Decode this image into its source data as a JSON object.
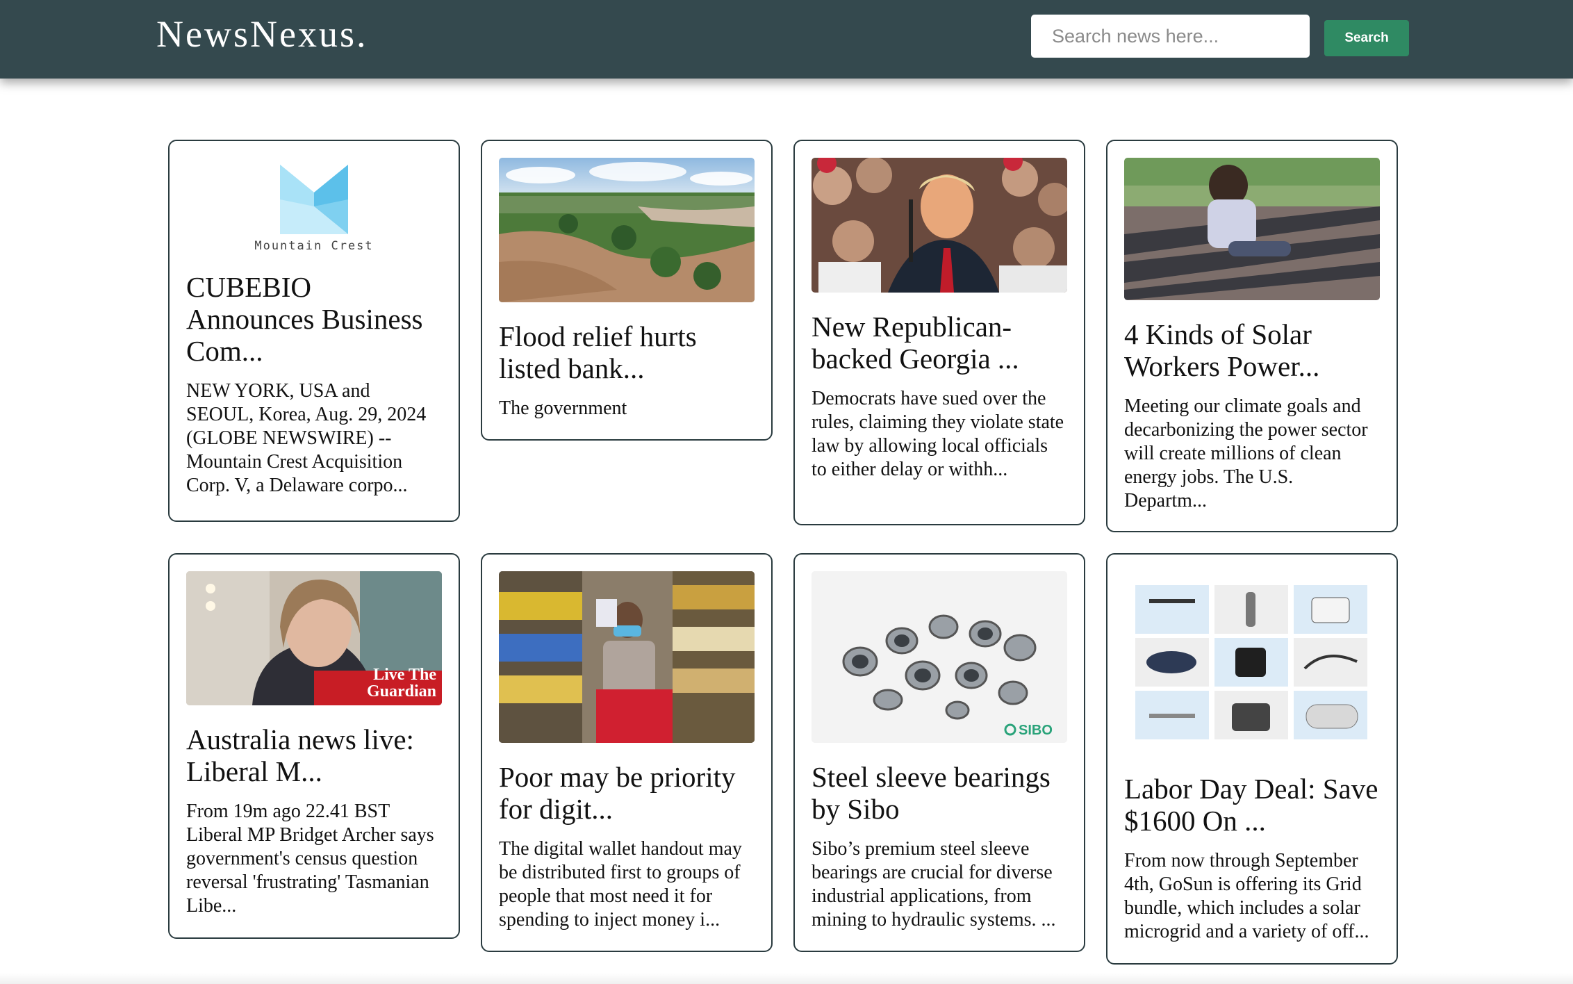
{
  "brand": "NewsNexus.",
  "search": {
    "placeholder": "Search news here...",
    "button_label": "Search"
  },
  "articles": [
    {
      "title": "CUBEBIO Announces Business Com...",
      "description": "NEW YORK, USA and SEOUL, Korea, Aug. 29, 2024 (GLOBE NEWSWIRE) -- Mountain Crest Acquisition Corp. V, a Delaware corpo...",
      "image_logo_text": "Mountain Crest"
    },
    {
      "title": "Flood relief hurts listed bank...",
      "description": "The government"
    },
    {
      "title": "New Republican-backed Georgia ...",
      "description": "Democrats have sued over the rules, claiming they violate state law by allowing local officials to either delay or withh..."
    },
    {
      "title": "4 Kinds of Solar Workers Power...",
      "description": "Meeting our climate goals and decarbonizing the power sector will create millions of clean energy jobs. The U.S. Departm..."
    },
    {
      "title": "Australia news live: Liberal M...",
      "description": "From 19m ago 22.41 BST Liberal MP Bridget Archer says government's census question reversal 'frustrating' Tasmanian Libe...",
      "image_badge_text": "Live The Guardian"
    },
    {
      "title": "Poor may be priority for digit...",
      "description": "The digital wallet handout may be distributed first to groups of people that most need it for spending to inject money i..."
    },
    {
      "title": "Steel sleeve bearings by Sibo",
      "description": "Sibo’s premium steel sleeve bearings are crucial for diverse industrial applications, from mining to hydraulic systems. ...",
      "image_logo_text": "SIBO"
    },
    {
      "title": "Labor Day Deal: Save $1600 On ...",
      "description": "From now through September 4th, GoSun is offering its Grid bundle, which includes a solar microgrid and a variety of off..."
    }
  ],
  "colors": {
    "navbar": "#34494e",
    "search_button": "#2f8a63",
    "card_border": "#2a3b3f"
  }
}
